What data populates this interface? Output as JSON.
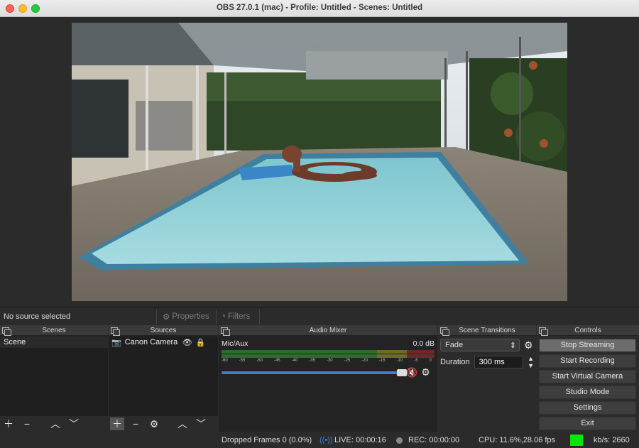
{
  "window": {
    "title": "OBS 27.0.1 (mac) - Profile: Untitled - Scenes: Untitled"
  },
  "source_toolbar": {
    "no_source": "No source selected",
    "properties": "Properties",
    "filters": "Filters"
  },
  "docks": {
    "scenes": {
      "title": "Scenes",
      "items": [
        "Scene"
      ]
    },
    "sources": {
      "title": "Sources",
      "items": [
        {
          "name": "Canon Camera",
          "icon": "camera-icon"
        }
      ]
    },
    "mixer": {
      "title": "Audio Mixer",
      "channel": "Mic/Aux",
      "level": "0.0 dB",
      "scale": [
        "-60",
        "-55",
        "-50",
        "-45",
        "-40",
        "-35",
        "-30",
        "-25",
        "-20",
        "-15",
        "-10",
        "-5",
        "0"
      ],
      "volume_fraction": 1.0
    },
    "transitions": {
      "title": "Scene Transitions",
      "selected": "Fade",
      "duration_label": "Duration",
      "duration_value": "300 ms"
    },
    "controls": {
      "title": "Controls",
      "buttons": [
        "Stop Streaming",
        "Start Recording",
        "Start Virtual Camera",
        "Studio Mode",
        "Settings",
        "Exit"
      ]
    }
  },
  "status": {
    "dropped": "Dropped Frames 0 (0.0%)",
    "live": "LIVE: 00:00:16",
    "rec": "REC: 00:00:00",
    "cpu": "CPU: 11.6%,28.06 fps",
    "kbs": "kb/s: 2660"
  },
  "colors": {
    "accent": "#3d7fd6",
    "health": "#00e600",
    "muted": "#d63232"
  }
}
